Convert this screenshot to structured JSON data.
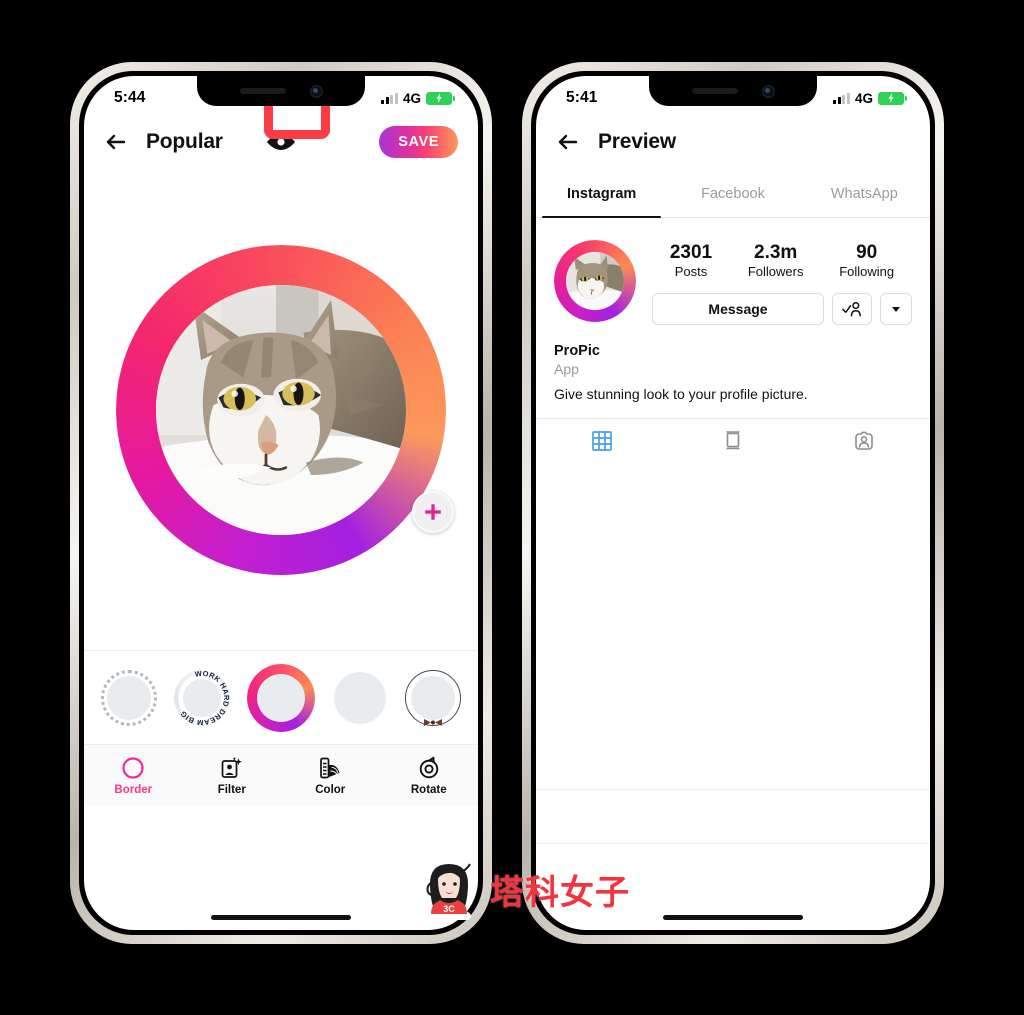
{
  "watermark": {
    "text": "塔科女子",
    "badge": "3C"
  },
  "phone_left": {
    "status": {
      "time": "5:44",
      "network": "4G",
      "battery_state": "charging"
    },
    "appbar": {
      "title": "Popular",
      "back_icon": "back-arrow-icon",
      "preview_icon": "eye-icon",
      "save_label": "SAVE"
    },
    "highlight": {
      "target": "preview-eye-button",
      "color": "#fc3b44"
    },
    "editor": {
      "border_style": "triple-gradient-ring",
      "add_button_icon": "plus-icon",
      "thumbnails": [
        {
          "name": "dotted-ring-border",
          "selected": false
        },
        {
          "name": "work-hard-dream-big-text-border",
          "text": "WORK HARD DREAM BIG",
          "selected": false
        },
        {
          "name": "gradient-triple-ring-border",
          "selected": true
        },
        {
          "name": "plain-no-border",
          "selected": false
        },
        {
          "name": "thin-ring-bowtie-border",
          "selected": false
        }
      ]
    },
    "tools": [
      {
        "label": "Border",
        "icon": "circle-border-icon",
        "active": true
      },
      {
        "label": "Filter",
        "icon": "filter-portrait-icon",
        "active": false
      },
      {
        "label": "Color",
        "icon": "color-swatch-icon",
        "active": false
      },
      {
        "label": "Rotate",
        "icon": "rotate-icon",
        "active": false
      }
    ]
  },
  "phone_right": {
    "status": {
      "time": "5:41",
      "network": "4G",
      "battery_state": "charging"
    },
    "appbar": {
      "title": "Preview",
      "back_icon": "back-arrow-icon"
    },
    "tabs": [
      {
        "label": "Instagram",
        "active": true
      },
      {
        "label": "Facebook",
        "active": false
      },
      {
        "label": "WhatsApp",
        "active": false
      }
    ],
    "profile": {
      "avatar_name": "profile-avatar-with-gradient-ring",
      "stats": [
        {
          "value": "2301",
          "label": "Posts"
        },
        {
          "value": "2.3m",
          "label": "Followers"
        },
        {
          "value": "90",
          "label": "Following"
        }
      ],
      "message_label": "Message",
      "follow_icon": "person-check-icon",
      "dropdown_icon": "chevron-down-icon",
      "name": "ProPic",
      "category": "App",
      "description": "Give stunning look to your profile picture."
    },
    "content_tabs": [
      {
        "name": "grid-icon",
        "active": true,
        "color": "#4a9fe8"
      },
      {
        "name": "reels-icon",
        "active": false
      },
      {
        "name": "tagged-person-icon",
        "active": false
      }
    ]
  }
}
